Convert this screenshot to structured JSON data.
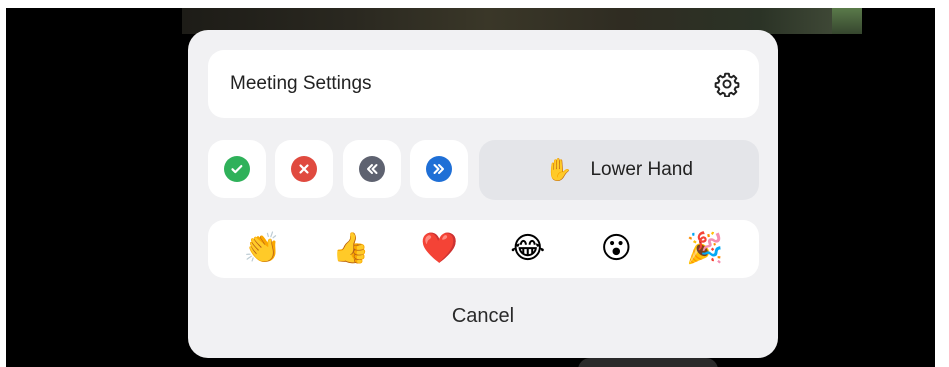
{
  "header": {
    "title": "Meeting Settings",
    "settings_icon": "gear-icon"
  },
  "status_buttons": [
    {
      "name": "yes-button",
      "icon": "check-icon",
      "color": "#2fb15a"
    },
    {
      "name": "no-button",
      "icon": "close-icon",
      "color": "#e04a3f"
    },
    {
      "name": "slower-button",
      "icon": "rewind-icon",
      "color": "#5e6270"
    },
    {
      "name": "faster-button",
      "icon": "fast-forward-icon",
      "color": "#1f6fd6"
    }
  ],
  "hand": {
    "emoji": "✋",
    "label": "Lower Hand"
  },
  "reactions": [
    {
      "name": "clap",
      "emoji": "👏"
    },
    {
      "name": "thumbs-up",
      "emoji": "👍"
    },
    {
      "name": "heart",
      "emoji": "❤️"
    },
    {
      "name": "joy",
      "emoji": "😂"
    },
    {
      "name": "open-mouth",
      "emoji": "😮"
    },
    {
      "name": "tada",
      "emoji": "🎉"
    }
  ],
  "cancel_label": "Cancel"
}
